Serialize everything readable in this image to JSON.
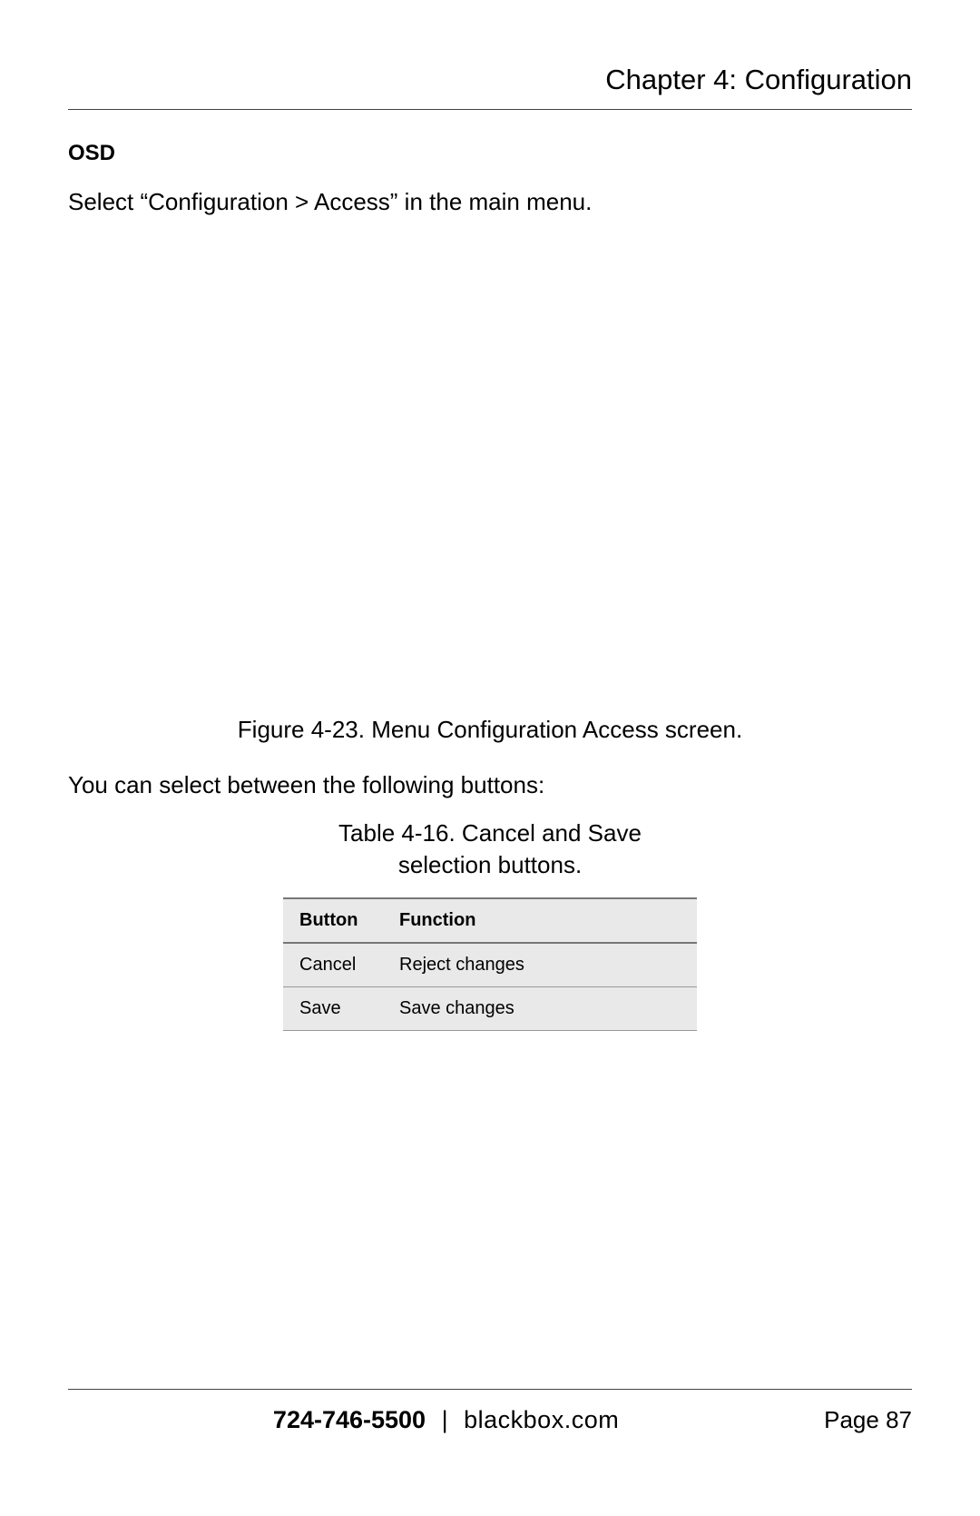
{
  "header": {
    "chapter_title": "Chapter 4: Configuration"
  },
  "section": {
    "heading": "OSD",
    "instruction": "Select “Configuration > Access” in the main menu."
  },
  "figure": {
    "caption": "Figure 4-23. Menu Configuration Access screen."
  },
  "post_figure_text": "You can select between the following buttons:",
  "table": {
    "caption": "Table 4-16. Cancel and Save selection buttons.",
    "headers": {
      "button": "Button",
      "function": "Function"
    },
    "rows": [
      {
        "button": "Cancel",
        "function": "Reject changes"
      },
      {
        "button": "Save",
        "function": "Save changes"
      }
    ]
  },
  "footer": {
    "phone": "724-746-5500",
    "separator": "|",
    "website": "blackbox.com",
    "page_label": "Page 87"
  }
}
